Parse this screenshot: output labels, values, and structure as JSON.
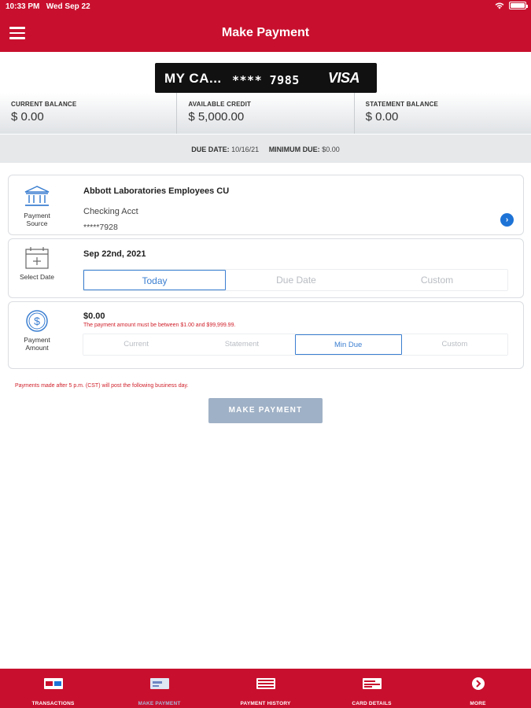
{
  "status": {
    "time": "10:33 PM",
    "date": "Wed Sep 22"
  },
  "header": {
    "title": "Make Payment"
  },
  "card": {
    "name": "MY CA...",
    "number": "**** 7985",
    "brand": "VISA"
  },
  "balances": {
    "current_label": "CURRENT BALANCE",
    "current_value": "$ 0.00",
    "available_label": "AVAILABLE CREDIT",
    "available_value": "$ 5,000.00",
    "statement_label": "STATEMENT BALANCE",
    "statement_value": "$ 0.00"
  },
  "due": {
    "date_label": "DUE DATE:",
    "date_value": "10/16/21",
    "min_label": "MINIMUM DUE:",
    "min_value": "$0.00"
  },
  "source": {
    "icon_label": "Payment Source",
    "bank": "Abbott Laboratories Employees CU",
    "account": "Checking Acct",
    "account_number": "*****7928"
  },
  "date": {
    "icon_label": "Select Date",
    "value": "Sep 22nd, 2021",
    "options": [
      "Today",
      "Due Date",
      "Custom"
    ],
    "selected": "Today"
  },
  "amount": {
    "icon_label": "Payment Amount",
    "value": "$0.00",
    "error": "The payment amount must be between $1.00 and $99,999.99.",
    "options": [
      "Current",
      "Statement",
      "Min Due",
      "Custom"
    ],
    "selected": "Min Due"
  },
  "notice": "Payments made after 5 p.m. (CST) will post the following business day.",
  "make_payment_button": "MAKE PAYMENT",
  "tabs": [
    {
      "label": "TRANSACTIONS",
      "icon": "transactions-icon"
    },
    {
      "label": "MAKE PAYMENT",
      "icon": "make-payment-icon",
      "active": true
    },
    {
      "label": "PAYMENT HISTORY",
      "icon": "payment-history-icon"
    },
    {
      "label": "CARD DETAILS",
      "icon": "card-details-icon"
    },
    {
      "label": "MORE",
      "icon": "more-icon"
    }
  ],
  "colors": {
    "brand_red": "#c8102e",
    "link_blue": "#1e73d6",
    "error_red": "#d0212b",
    "disabled_button": "#9fb1c6"
  }
}
